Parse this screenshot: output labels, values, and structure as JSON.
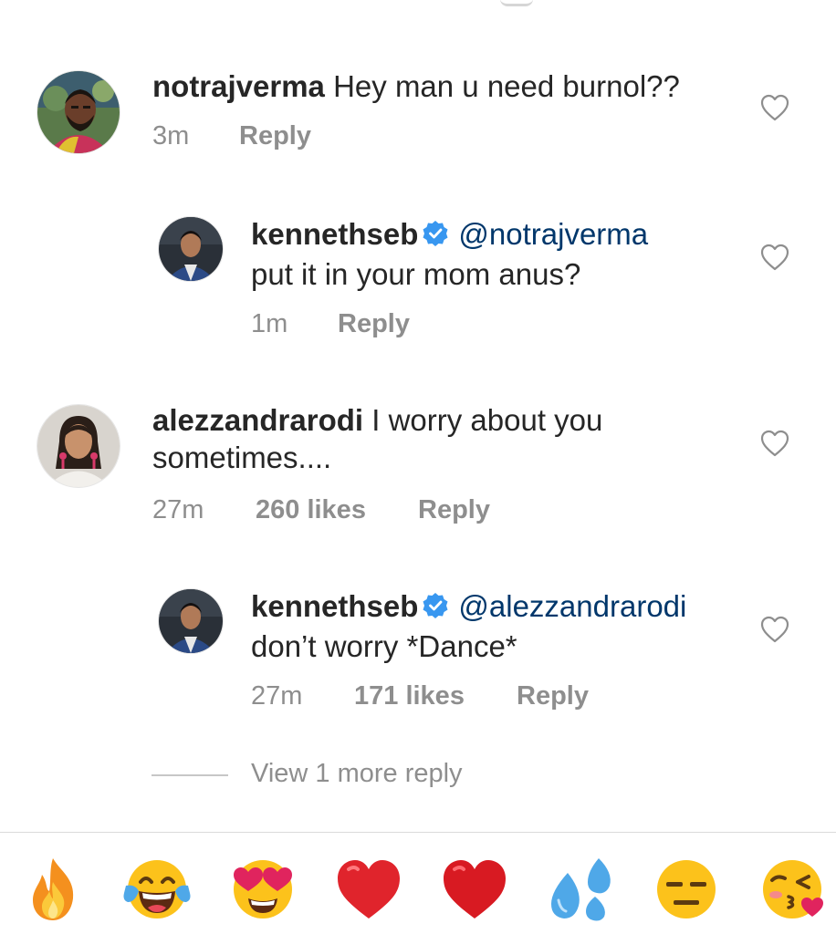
{
  "comments": [
    {
      "username": "notrajverma",
      "text": "Hey man u need burnol??",
      "time": "3m",
      "reply_label": "Reply"
    },
    {
      "username": "kennethseb",
      "verified": true,
      "mention": "@notrajverma",
      "text": "put it in your mom anus?",
      "time": "1m",
      "reply_label": "Reply"
    },
    {
      "username": "alezzandrarodi",
      "text_line1": "I worry about you",
      "text_line2": "sometimes....",
      "time": "27m",
      "likes": "260 likes",
      "reply_label": "Reply"
    },
    {
      "username": "kennethseb",
      "verified": true,
      "mention": "@alezzandrarodi",
      "text": "don’t worry *Dance*",
      "time": "27m",
      "likes": "171 likes",
      "reply_label": "Reply"
    }
  ],
  "view_more_replies": "View 1 more reply",
  "emoji_bar": [
    "fire-emoji",
    "tears-of-joy-emoji",
    "heart-eyes-emoji",
    "red-heart-emoji",
    "red-heart-emoji",
    "sweat-droplets-emoji",
    "expressionless-emoji",
    "kissing-face-emoji"
  ],
  "colors": {
    "text": "#262626",
    "secondary": "#8e8e8e",
    "mention": "#00376b",
    "verified": "#3897f0",
    "heart": "#e0245e"
  }
}
